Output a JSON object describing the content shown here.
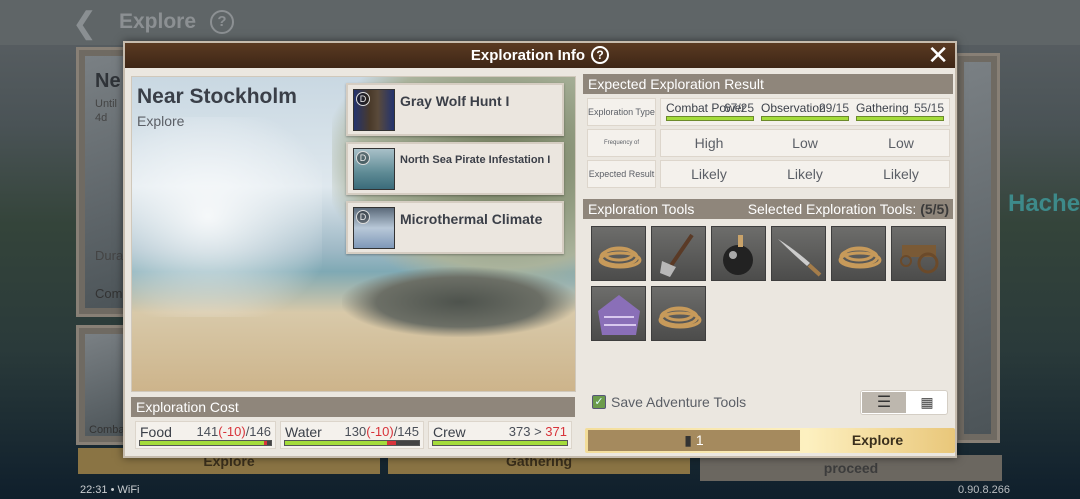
{
  "background": {
    "title": "Explore",
    "left_card": {
      "title": "Ne",
      "line1": "Until",
      "line2": "4d",
      "dur": "Dura",
      "com": "Com"
    },
    "lower_card_label": "Comba",
    "buttons": [
      "Explore",
      "Gathering",
      "proceed"
    ],
    "right_text": "Hache",
    "status": {
      "time": "22:31",
      "network": "WiFi"
    },
    "version": "0.90.8.266"
  },
  "modal": {
    "title": "Exploration Info",
    "location": "Near Stockholm",
    "location_type": "Explore",
    "events": [
      {
        "name": "Gray Wolf Hunt  I",
        "badge": "D",
        "icon": "wolf-hunt-icon"
      },
      {
        "name": "North Sea Pirate Infestation  I",
        "badge": "D",
        "icon": "pirate-icon"
      },
      {
        "name": "Microthermal Climate",
        "badge": "D",
        "icon": "climate-icon"
      }
    ],
    "cost": {
      "header": "Exploration Cost",
      "items": [
        {
          "label": "Food",
          "current": "141",
          "delta": "(-10)",
          "max": "/146",
          "fill": 0.966,
          "cost_fraction": 0.02
        },
        {
          "label": "Water",
          "current": "130",
          "delta": "(-10)",
          "max": "/145",
          "fill": 0.83,
          "cost_fraction": 0.07
        },
        {
          "label": "Crew",
          "current": "373 > ",
          "delta": "371",
          "max": "",
          "fill": 1.0,
          "cost_fraction": 0
        }
      ]
    },
    "result": {
      "header": "Expected Exploration Result",
      "row_labels": [
        "Exploration Type",
        "Frequency of appearance",
        "Expected Result"
      ],
      "types": [
        {
          "name": "Combat Power",
          "value": "67/25",
          "frequency": "High",
          "result": "Likely"
        },
        {
          "name": "Observation",
          "value": "29/15",
          "frequency": "Low",
          "result": "Likely"
        },
        {
          "name": "Gathering",
          "value": "55/15",
          "frequency": "Low",
          "result": "Likely"
        }
      ]
    },
    "tools": {
      "header": "Exploration Tools",
      "selected_label": "Selected Exploration Tools:",
      "selected_count": "(5/5)",
      "items": [
        "rope",
        "axe",
        "bomb",
        "machete",
        "rope",
        "cart",
        "poncho",
        "rope"
      ]
    },
    "save_tools_label": "Save Adventure Tools",
    "save_tools_checked": true,
    "ticket_count": "1",
    "explore_button": "Explore"
  }
}
